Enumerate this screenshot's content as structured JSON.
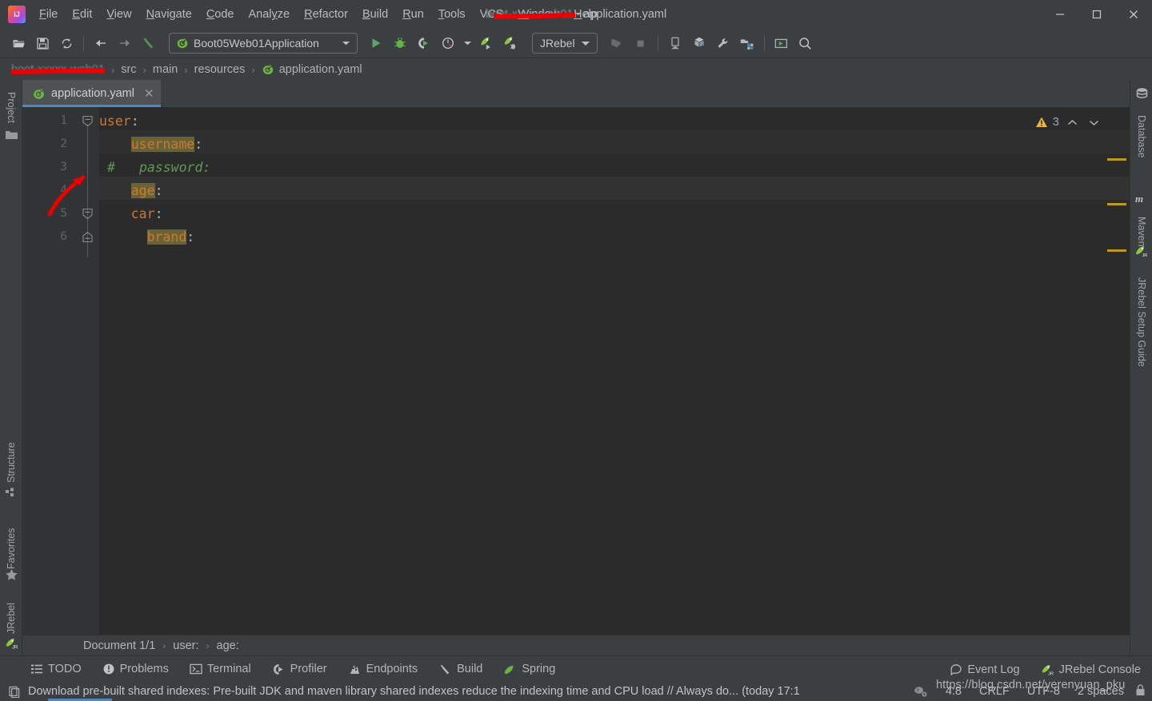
{
  "window": {
    "title_redacted": "boot-xxxx-web01",
    "title_suffix": " - application.yaml",
    "minimize": "–",
    "maximize": "□",
    "close": "✕"
  },
  "menubar": {
    "items": [
      {
        "label": "File",
        "mnemonic": "F"
      },
      {
        "label": "Edit",
        "mnemonic": "E"
      },
      {
        "label": "View",
        "mnemonic": "V"
      },
      {
        "label": "Navigate",
        "mnemonic": "N"
      },
      {
        "label": "Code",
        "mnemonic": "C"
      },
      {
        "label": "Analyze",
        "mnemonic": "y"
      },
      {
        "label": "Refactor",
        "mnemonic": "R"
      },
      {
        "label": "Build",
        "mnemonic": "B"
      },
      {
        "label": "Run",
        "mnemonic": "R"
      },
      {
        "label": "Tools",
        "mnemonic": "T"
      },
      {
        "label": "VCS",
        "mnemonic": ""
      },
      {
        "label": "Window",
        "mnemonic": "W"
      },
      {
        "label": "Help",
        "mnemonic": "H"
      }
    ]
  },
  "toolbar": {
    "open_tip": "open-project",
    "save_tip": "save-all",
    "sync_tip": "sync",
    "back_tip": "back",
    "forward_tip": "forward",
    "build_tip": "build-project",
    "run_config": "Boot05Web01Application",
    "run_tip": "run",
    "debug_tip": "debug",
    "run_coverage_tip": "run-with-coverage",
    "profiler_tip": "profiler",
    "jrebel_run_tip": "jrebel-run",
    "jrebel_debug_tip": "jrebel-debug",
    "jrebel_combo": "JRebel",
    "update_app_tip": "update-running-application",
    "stop_tip": "stop",
    "device_tip": "device-manager",
    "publish_tip": "publish",
    "settings_tip": "settings",
    "project_structure_tip": "project-structure",
    "terminal_tip": "terminal",
    "search_tip": "search-everywhere"
  },
  "breadcrumb": {
    "project_redacted": "boot-xxxxx-web01",
    "items": [
      "src",
      "main",
      "resources",
      "application.yaml"
    ],
    "separator": "›"
  },
  "left_tool_window": {
    "project": "Project",
    "structure": "Structure",
    "favorites": "Favorites",
    "jrebel": "JRebel"
  },
  "right_tool_window": {
    "database": "Database",
    "maven": "Maven",
    "jrebel_setup_guide": "JRebel Setup Guide"
  },
  "editor": {
    "tab": {
      "label": "application.yaml",
      "close": "✕"
    },
    "inspection": {
      "count": "3",
      "icon": "warning-triangle-icon",
      "up": "⌃",
      "down": "⌄"
    },
    "lines": [
      {
        "num": "1",
        "indent": 0,
        "key": "user",
        "highlight": false,
        "comment": false,
        "current": false
      },
      {
        "num": "2",
        "indent": 2,
        "key": "username",
        "highlight": true,
        "comment": false,
        "current": false
      },
      {
        "num": "3",
        "indent": 0,
        "key": "password",
        "highlight": false,
        "comment": true,
        "current": false
      },
      {
        "num": "4",
        "indent": 2,
        "key": "age",
        "highlight": true,
        "comment": false,
        "current": true
      },
      {
        "num": "5",
        "indent": 2,
        "key": "car",
        "highlight": false,
        "comment": false,
        "current": false
      },
      {
        "num": "6",
        "indent": 3,
        "key": "brand",
        "highlight": true,
        "comment": false,
        "current": false
      }
    ],
    "comment_prefix": "#",
    "colon": ":"
  },
  "doc_bar": {
    "document": "Document 1/1",
    "crumbs": [
      "user:",
      "age:"
    ],
    "separator": "›"
  },
  "bottom_bar": {
    "left": [
      {
        "label": "TODO",
        "icon": "todo-list-icon"
      },
      {
        "label": "Problems",
        "icon": "problems-icon"
      },
      {
        "label": "Terminal",
        "icon": "terminal-icon"
      },
      {
        "label": "Profiler",
        "icon": "profiler-icon"
      },
      {
        "label": "Endpoints",
        "icon": "endpoints-icon"
      },
      {
        "label": "Build",
        "icon": "build-hammer-icon"
      },
      {
        "label": "Spring",
        "icon": "spring-leaf-icon"
      }
    ],
    "right": [
      {
        "label": "Event Log",
        "icon": "event-log-icon"
      },
      {
        "label": "JRebel Console",
        "icon": "jrebel-icon"
      }
    ]
  },
  "status_bar": {
    "message": "Download pre-built shared indexes: Pre-built JDK and maven library shared indexes reduce the indexing time and CPU load // Always do... (today 17:1",
    "caret": "4:8",
    "line_sep": "CRLF",
    "encoding": "UTF-8",
    "indent": "2 spaces",
    "message_icon": "notification-icon",
    "inspection_icon": "inspection-level-icon"
  },
  "watermark": {
    "text": "https://blog.csdn.net/yerenyuan_pku"
  },
  "colors": {
    "accent_blue": "#4a88c7",
    "key_orange": "#cc7832",
    "comment_green": "#629755",
    "highlight_olive": "#6b6234",
    "warning_yellow": "#bb9a1f",
    "annotation_red": "#ee0000",
    "editor_bg": "#2b2b2b",
    "chrome_bg": "#3c3f41"
  }
}
